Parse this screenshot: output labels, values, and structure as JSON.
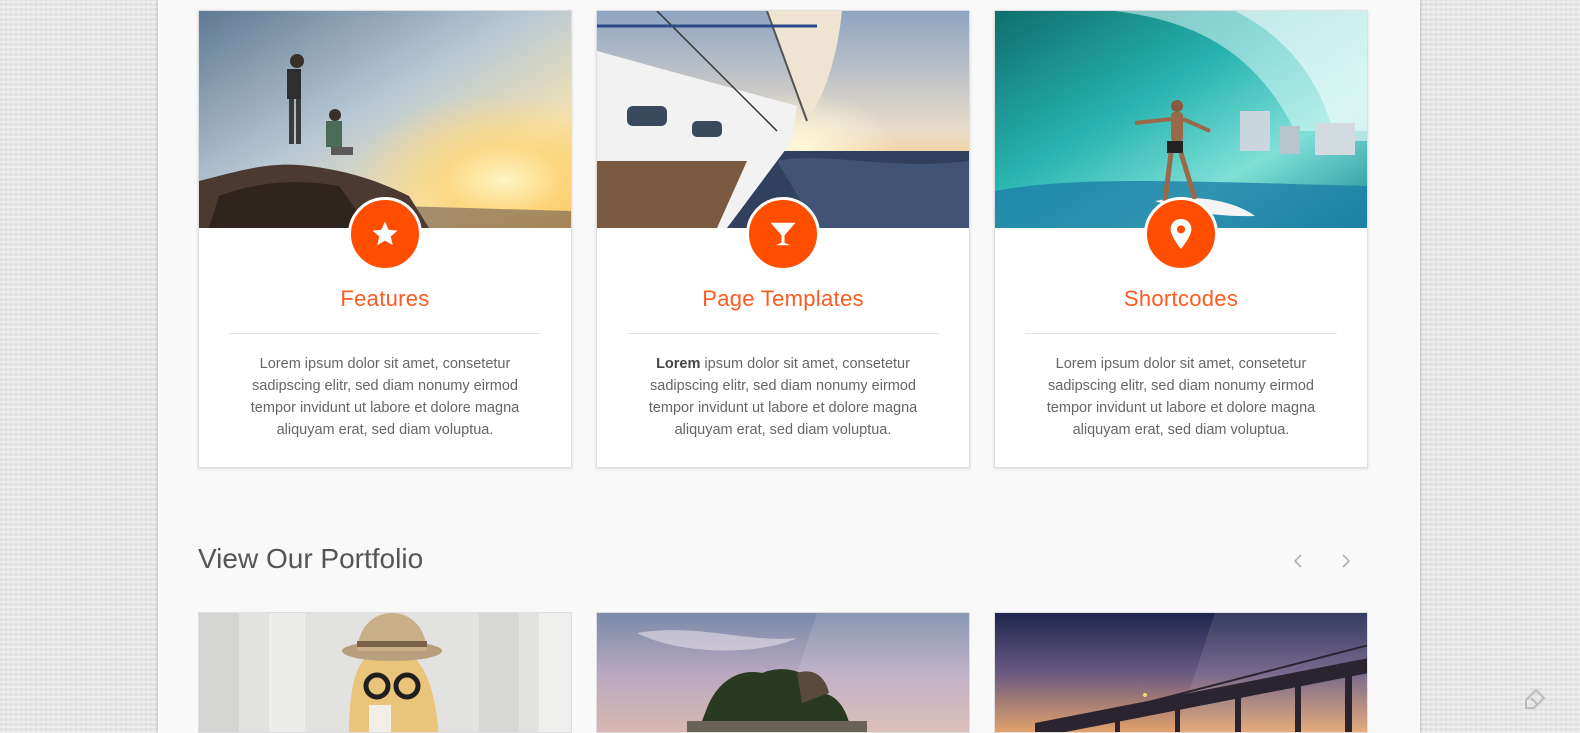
{
  "features": [
    {
      "title": "Features",
      "icon": "star-icon",
      "text_bold": "",
      "text": "Lorem ipsum dolor sit amet, consetetur sadipscing elitr, sed diam nonumy eirmod tempor invidunt ut labore et dolore magna aliquyam erat, sed diam voluptua."
    },
    {
      "title": "Page Templates",
      "icon": "cocktail-glass-icon",
      "text_bold": "Lorem",
      "text": " ipsum dolor sit amet, consetetur sadipscing elitr, sed diam nonumy eirmod tempor invidunt ut labore et dolore magna aliquyam erat, sed diam voluptua."
    },
    {
      "title": "Shortcodes",
      "icon": "map-pin-icon",
      "text_bold": "",
      "text": "Lorem ipsum dolor sit amet, consetetur sadipscing elitr, sed diam nonumy eirmod tempor invidunt ut labore et dolore magna aliquyam erat, sed diam voluptua."
    }
  ],
  "portfolio": {
    "title": "View Our Portfolio",
    "prev_icon": "chevron-left-icon",
    "next_icon": "chevron-right-icon"
  },
  "colors": {
    "accent": "#ff4e00",
    "title_accent": "#ff5a1f",
    "body_text": "#666666"
  }
}
